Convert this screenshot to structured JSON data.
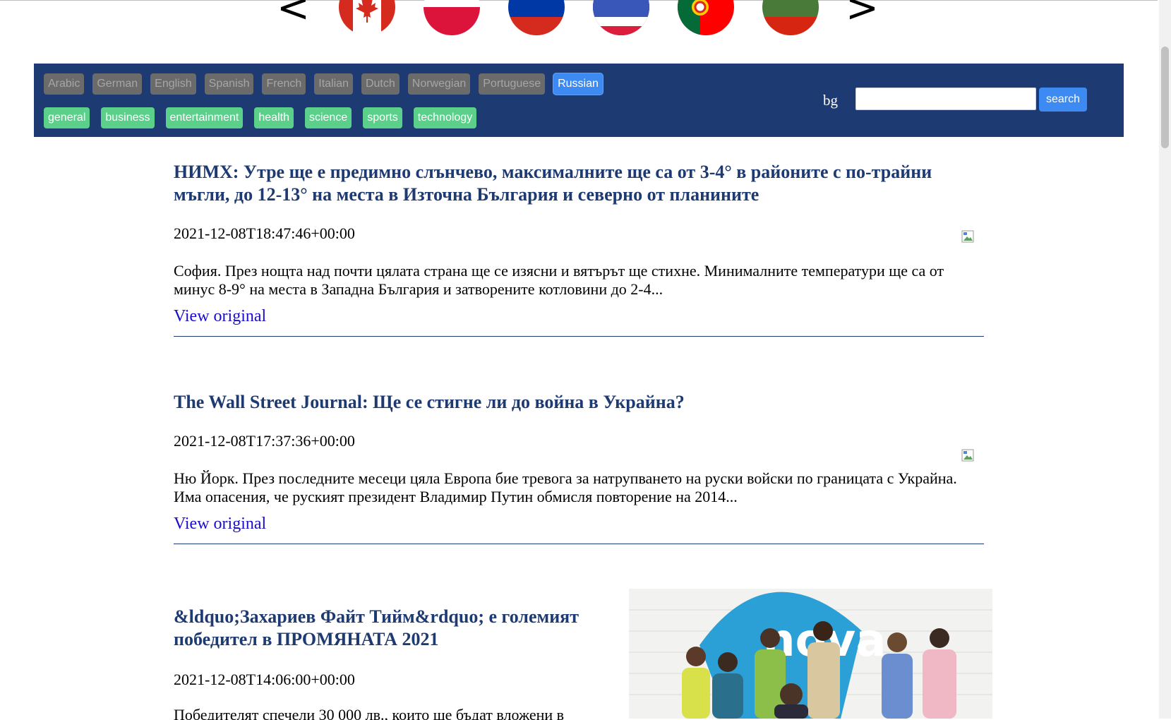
{
  "flags": {
    "prev_label": "<",
    "next_label": ">",
    "items": [
      {
        "name": "canada-flag-icon"
      },
      {
        "name": "poland-flag-icon"
      },
      {
        "name": "russia-flag-icon"
      },
      {
        "name": "thailand-flag-icon"
      },
      {
        "name": "portugal-flag-icon"
      },
      {
        "name": "bulgaria-flag-icon"
      }
    ]
  },
  "nav": {
    "languages": [
      "Arabic",
      "German",
      "English",
      "Spanish",
      "French",
      "Italian",
      "Dutch",
      "Norwegian",
      "Portuguese",
      "Russian"
    ],
    "active_language": "Russian",
    "categories": [
      "general",
      "business",
      "entertainment",
      "health",
      "science",
      "sports",
      "technology"
    ],
    "country_code": "bg",
    "search": {
      "value": "",
      "button_label": "search"
    }
  },
  "articles": [
    {
      "title": "НИМХ: Утре ще е предимно слънчево, максималните ще са от 3-4° в районите с по-трайни мъгли, до 12-13° на места в Източна България и северно от планините",
      "date": "2021-12-08T18:47:46+00:00",
      "description": "София. През нощта над почти цялата страна ще се изясни и вятърът ще стихне. Минималните температури ще са от минус 8-9° на места в Западна България и затворените котловини до 2-4...",
      "link_label": "View original"
    },
    {
      "title": "The Wall Street Journal: Ще се стигне ли до война в Украйна?",
      "date": "2021-12-08T17:37:36+00:00",
      "description": "Ню Йорк. През последните месеци цяла Европа бие тревога за натрупването на руски войски по границата с Украйна. Има опасения, че руският президент Владимир Путин обмисля повторение на 2014...",
      "link_label": "View original"
    },
    {
      "title": "&ldquo;Захариев Файт Тийм&rdquo; е големият победител в ПРОМЯНАТА 2021",
      "date": "2021-12-08T14:06:00+00:00",
      "description": "Победителят спечели 30 000 лв., които ще бъдат вложени в"
    }
  ],
  "colors": {
    "navbar": "#1e3a72",
    "title": "#1e3a72",
    "active_lang": "#3d8bf2",
    "category": "#5ad08a",
    "link": "#1a0dcc"
  }
}
